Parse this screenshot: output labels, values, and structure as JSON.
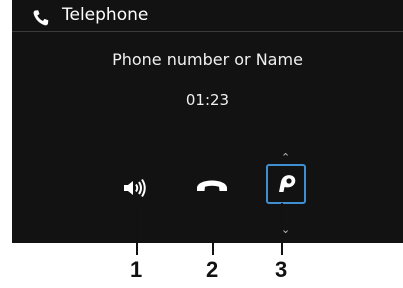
{
  "header": {
    "title": "Telephone",
    "icon": "phone-icon"
  },
  "call": {
    "name": "Phone number or Name",
    "duration": "01:23"
  },
  "controls": [
    {
      "id": "speaker",
      "icon": "speaker-volume-icon"
    },
    {
      "id": "end-call",
      "icon": "hang-up-icon"
    },
    {
      "id": "voice-assistant",
      "icon": "voice-control-icon",
      "selected": true
    }
  ],
  "callouts": [
    "1",
    "2",
    "3"
  ],
  "colors": {
    "screen_bg": "#121212",
    "highlight": "#3f8fd0",
    "text": "#ffffff"
  }
}
